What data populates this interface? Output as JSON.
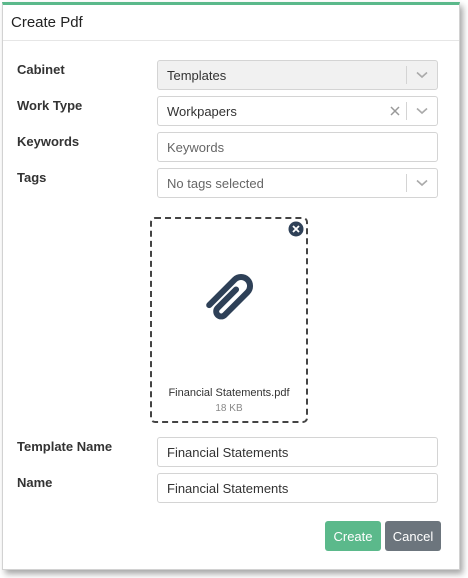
{
  "dialog": {
    "title": "Create Pdf"
  },
  "fields": {
    "cabinet": {
      "label": "Cabinet",
      "value": "Templates"
    },
    "work_type": {
      "label": "Work Type",
      "value": "Workpapers"
    },
    "keywords": {
      "label": "Keywords",
      "placeholder": "Keywords",
      "value": ""
    },
    "tags": {
      "label": "Tags",
      "placeholder": "No tags selected"
    },
    "template_name": {
      "label": "Template Name",
      "value": "Financial Statements"
    },
    "name": {
      "label": "Name",
      "value": "Financial Statements"
    }
  },
  "attachment": {
    "file_name": "Financial Statements.pdf",
    "file_size": "18 KB",
    "icon": "paperclip-icon"
  },
  "buttons": {
    "create": "Create",
    "cancel": "Cancel"
  },
  "colors": {
    "accent": "#5bb98b",
    "cancel": "#6c757d",
    "icon": "#2e4057"
  }
}
